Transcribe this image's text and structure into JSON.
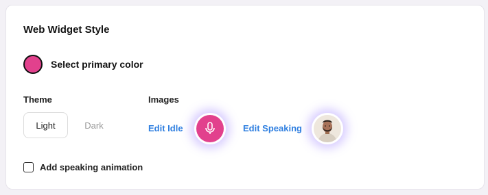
{
  "widget": {
    "title": "Web Widget Style",
    "primary_color": {
      "label": "Select primary color",
      "value": "#e2418d"
    },
    "theme": {
      "label": "Theme",
      "options": [
        "Light",
        "Dark"
      ],
      "selected": "Light"
    },
    "images": {
      "label": "Images",
      "edit_idle_label": "Edit Idle",
      "idle_icon": "microphone-icon",
      "edit_speaking_label": "Edit Speaking",
      "speaking_image": "avatar-photo-man"
    },
    "speaking_animation": {
      "label": "Add speaking animation",
      "checked": false
    }
  }
}
